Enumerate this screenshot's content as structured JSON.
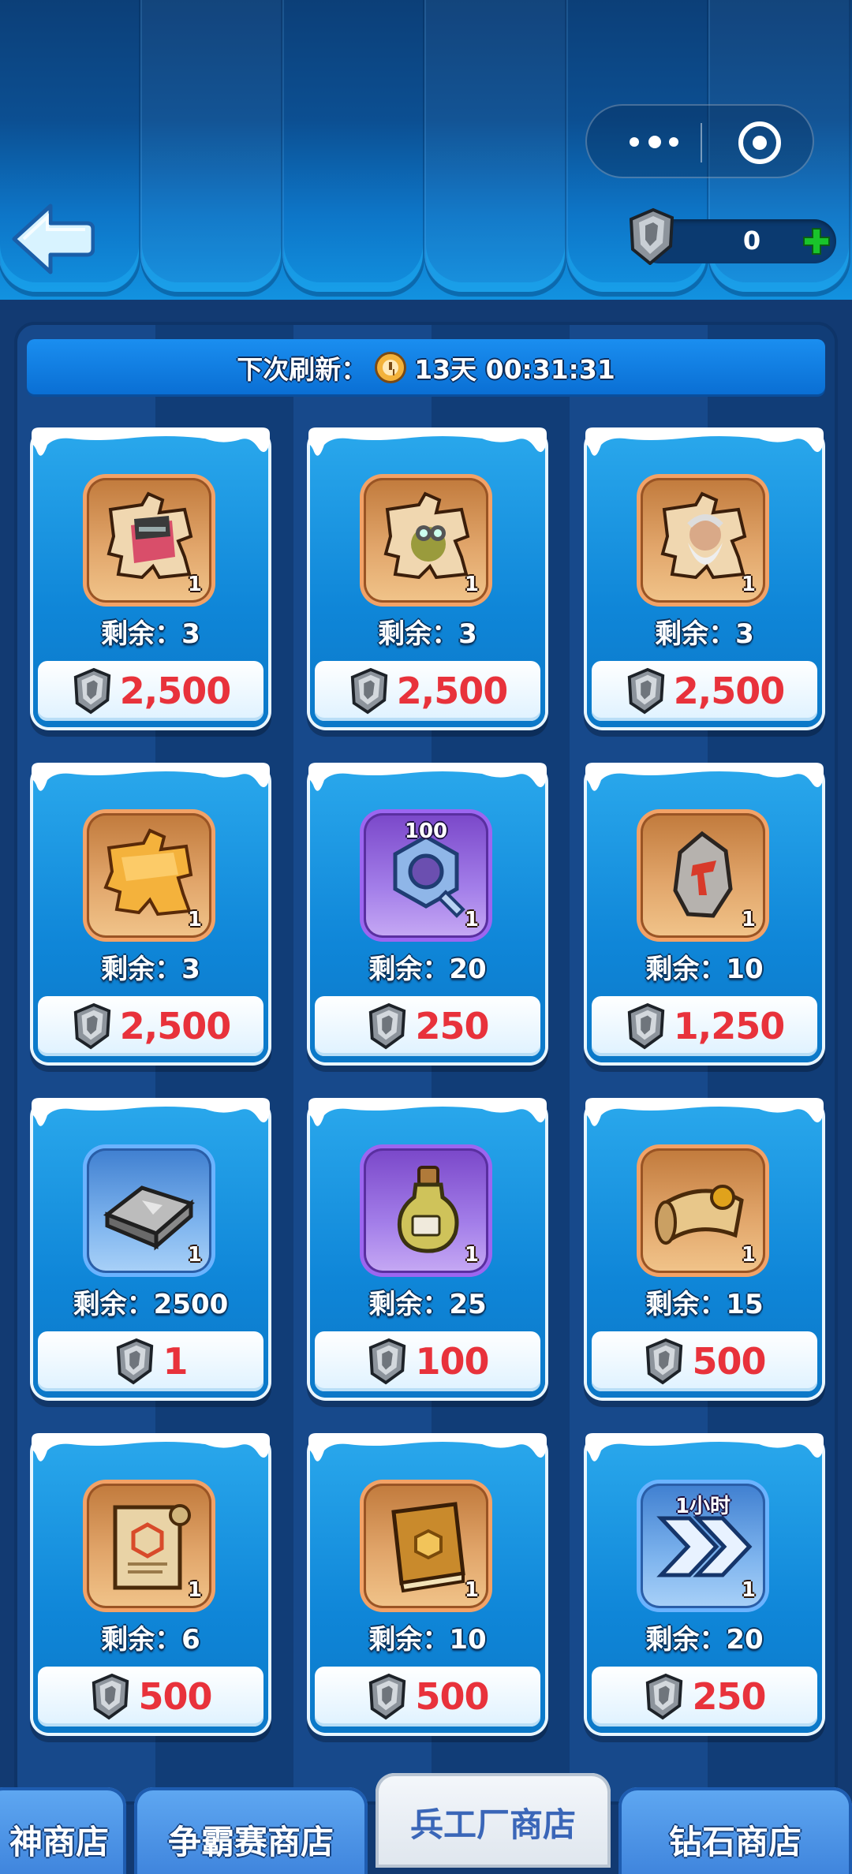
{
  "header": {
    "currency_amount": "0",
    "colors": {
      "accent_green": "#19c42b",
      "price_red": "#e8323b"
    }
  },
  "refresh": {
    "label": "下次刷新：",
    "countdown": "13天 00:31:31"
  },
  "items": [
    {
      "remaining": "剩余：3",
      "price": "2,500",
      "qty": "1",
      "frame": "orange",
      "icon": "hero-puzzle-knight-icon"
    },
    {
      "remaining": "剩余：3",
      "price": "2,500",
      "qty": "1",
      "frame": "orange",
      "icon": "hero-puzzle-goggles-icon"
    },
    {
      "remaining": "剩余：3",
      "price": "2,500",
      "qty": "1",
      "frame": "orange",
      "icon": "hero-puzzle-old-man-icon"
    },
    {
      "remaining": "剩余：3",
      "price": "2,500",
      "qty": "1",
      "frame": "orange",
      "icon": "puzzle-piece-icon"
    },
    {
      "remaining": "剩余：20",
      "price": "250",
      "qty": "1",
      "frame": "purple",
      "icon": "hex-nut-icon",
      "top_label": "100"
    },
    {
      "remaining": "剩余：10",
      "price": "1,250",
      "qty": "1",
      "frame": "orange",
      "icon": "ore-stone-icon"
    },
    {
      "remaining": "剩余：2500",
      "price": "1",
      "qty": "1",
      "frame": "blue",
      "icon": "iron-ingot-icon"
    },
    {
      "remaining": "剩余：25",
      "price": "100",
      "qty": "1",
      "frame": "purple",
      "icon": "potion-bottle-icon"
    },
    {
      "remaining": "剩余：15",
      "price": "500",
      "qty": "1",
      "frame": "orange",
      "icon": "scroll-icon"
    },
    {
      "remaining": "剩余：6",
      "price": "500",
      "qty": "1",
      "frame": "orange",
      "icon": "blueprint-scroll-icon"
    },
    {
      "remaining": "剩余：10",
      "price": "500",
      "qty": "1",
      "frame": "orange",
      "icon": "book-icon"
    },
    {
      "remaining": "剩余：20",
      "price": "250",
      "qty": "1",
      "frame": "blue",
      "icon": "speedup-arrows-icon",
      "top_label": "1小时"
    }
  ],
  "tabs": [
    {
      "label": "神商店",
      "active": false
    },
    {
      "label": "争霸赛商店",
      "active": false
    },
    {
      "label": "兵工厂商店",
      "active": true
    },
    {
      "label": "钻石商店",
      "active": false
    }
  ]
}
